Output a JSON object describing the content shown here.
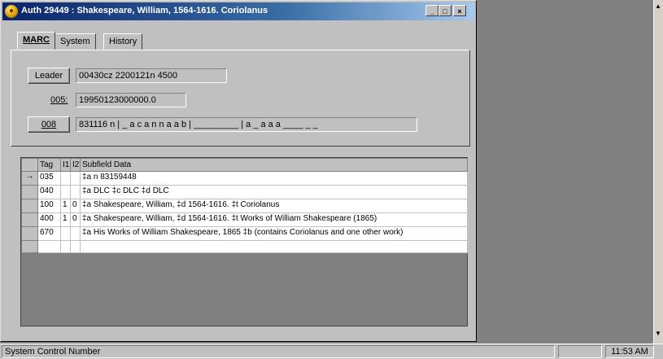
{
  "window": {
    "title": "Auth 29449 : Shakespeare, William, 1564-1616. Coriolanus",
    "minimize": "_",
    "maximize": "□",
    "close": "×"
  },
  "tabs": [
    "MARC",
    "System",
    "History"
  ],
  "fields": {
    "leader_label": "Leader",
    "leader_value": "00430cz  2200121n  4500",
    "f005_label": "005:",
    "f005_value": "19950123000000.0",
    "f008_label": "008",
    "f008_value": "831116 n | _ a c a n n a a b | _________ | a _ a a a ____ _ _"
  },
  "grid": {
    "headers": [
      "",
      "Tag",
      "I1",
      "I2",
      "Subfield Data"
    ],
    "rows": [
      {
        "marker": "→",
        "tag": "035",
        "i1": "",
        "i2": "",
        "data": "‡a n  83159448"
      },
      {
        "marker": "",
        "tag": "040",
        "i1": "",
        "i2": "",
        "data": "‡a DLC ‡c DLC ‡d DLC"
      },
      {
        "marker": "",
        "tag": "100",
        "i1": "1",
        "i2": "0",
        "data": "‡a Shakespeare, William, ‡d 1564-1616. ‡t Coriolanus"
      },
      {
        "marker": "",
        "tag": "400",
        "i1": "1",
        "i2": "0",
        "data": "‡a Shakespeare, William, ‡d 1564-1616. ‡t Works of William Shakespeare (1865)"
      },
      {
        "marker": "",
        "tag": "670",
        "i1": "",
        "i2": "",
        "data": "‡a His Works of William Shakespeare, 1865 ‡b (contains Coriolanus and one other work)"
      }
    ]
  },
  "status": {
    "text": "System Control Number",
    "time": "11:53 AM"
  }
}
